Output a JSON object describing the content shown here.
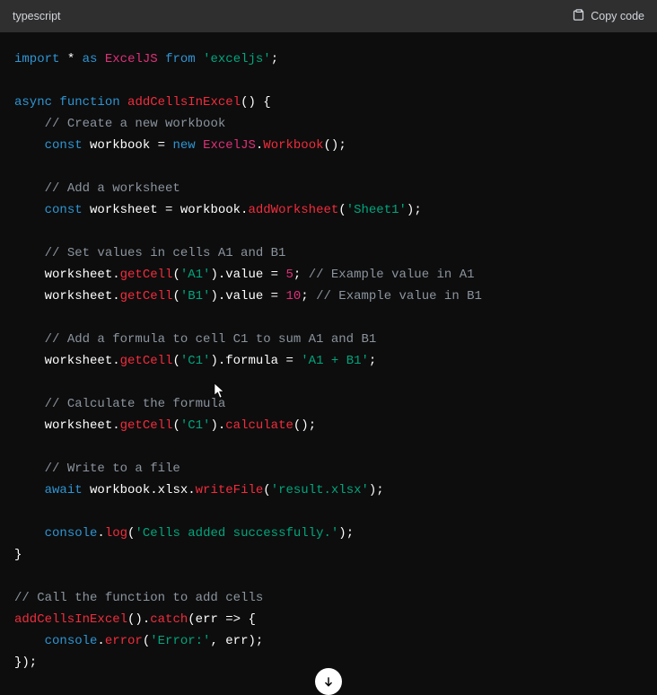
{
  "header": {
    "language": "typescript",
    "copy_label": "Copy code"
  },
  "code": {
    "tokens": [
      [
        {
          "t": "kw",
          "v": "import"
        },
        {
          "t": "pln",
          "v": " * "
        },
        {
          "t": "kw",
          "v": "as"
        },
        {
          "t": "pln",
          "v": " "
        },
        {
          "t": "mod",
          "v": "ExcelJS"
        },
        {
          "t": "pln",
          "v": " "
        },
        {
          "t": "kw",
          "v": "from"
        },
        {
          "t": "pln",
          "v": " "
        },
        {
          "t": "str",
          "v": "'exceljs'"
        },
        {
          "t": "pln",
          "v": ";"
        }
      ],
      [],
      [
        {
          "t": "kw",
          "v": "async"
        },
        {
          "t": "pln",
          "v": " "
        },
        {
          "t": "kw",
          "v": "function"
        },
        {
          "t": "pln",
          "v": " "
        },
        {
          "t": "fn",
          "v": "addCellsInExcel"
        },
        {
          "t": "pln",
          "v": "() {"
        }
      ],
      [
        {
          "t": "pln",
          "v": "    "
        },
        {
          "t": "cmt",
          "v": "// Create a new workbook"
        }
      ],
      [
        {
          "t": "pln",
          "v": "    "
        },
        {
          "t": "kw",
          "v": "const"
        },
        {
          "t": "pln",
          "v": " workbook = "
        },
        {
          "t": "kw",
          "v": "new"
        },
        {
          "t": "pln",
          "v": " "
        },
        {
          "t": "mod",
          "v": "ExcelJS"
        },
        {
          "t": "pln",
          "v": "."
        },
        {
          "t": "fn",
          "v": "Workbook"
        },
        {
          "t": "pln",
          "v": "();"
        }
      ],
      [],
      [
        {
          "t": "pln",
          "v": "    "
        },
        {
          "t": "cmt",
          "v": "// Add a worksheet"
        }
      ],
      [
        {
          "t": "pln",
          "v": "    "
        },
        {
          "t": "kw",
          "v": "const"
        },
        {
          "t": "pln",
          "v": " worksheet = workbook."
        },
        {
          "t": "fn",
          "v": "addWorksheet"
        },
        {
          "t": "pln",
          "v": "("
        },
        {
          "t": "str",
          "v": "'Sheet1'"
        },
        {
          "t": "pln",
          "v": ");"
        }
      ],
      [],
      [
        {
          "t": "pln",
          "v": "    "
        },
        {
          "t": "cmt",
          "v": "// Set values in cells A1 and B1"
        }
      ],
      [
        {
          "t": "pln",
          "v": "    worksheet."
        },
        {
          "t": "fn",
          "v": "getCell"
        },
        {
          "t": "pln",
          "v": "("
        },
        {
          "t": "str",
          "v": "'A1'"
        },
        {
          "t": "pln",
          "v": ").value = "
        },
        {
          "t": "num",
          "v": "5"
        },
        {
          "t": "pln",
          "v": "; "
        },
        {
          "t": "cmt",
          "v": "// Example value in A1"
        }
      ],
      [
        {
          "t": "pln",
          "v": "    worksheet."
        },
        {
          "t": "fn",
          "v": "getCell"
        },
        {
          "t": "pln",
          "v": "("
        },
        {
          "t": "str",
          "v": "'B1'"
        },
        {
          "t": "pln",
          "v": ").value = "
        },
        {
          "t": "num",
          "v": "10"
        },
        {
          "t": "pln",
          "v": "; "
        },
        {
          "t": "cmt",
          "v": "// Example value in B1"
        }
      ],
      [],
      [
        {
          "t": "pln",
          "v": "    "
        },
        {
          "t": "cmt",
          "v": "// Add a formula to cell C1 to sum A1 and B1"
        }
      ],
      [
        {
          "t": "pln",
          "v": "    worksheet."
        },
        {
          "t": "fn",
          "v": "getCell"
        },
        {
          "t": "pln",
          "v": "("
        },
        {
          "t": "str",
          "v": "'C1'"
        },
        {
          "t": "pln",
          "v": ").formula = "
        },
        {
          "t": "str",
          "v": "'A1 + B1'"
        },
        {
          "t": "pln",
          "v": ";"
        }
      ],
      [],
      [
        {
          "t": "pln",
          "v": "    "
        },
        {
          "t": "cmt",
          "v": "// Calculate the formula"
        }
      ],
      [
        {
          "t": "pln",
          "v": "    worksheet."
        },
        {
          "t": "fn",
          "v": "getCell"
        },
        {
          "t": "pln",
          "v": "("
        },
        {
          "t": "str",
          "v": "'C1'"
        },
        {
          "t": "pln",
          "v": ")."
        },
        {
          "t": "fn",
          "v": "calculate"
        },
        {
          "t": "pln",
          "v": "();"
        }
      ],
      [],
      [
        {
          "t": "pln",
          "v": "    "
        },
        {
          "t": "cmt",
          "v": "// Write to a file"
        }
      ],
      [
        {
          "t": "pln",
          "v": "    "
        },
        {
          "t": "kw",
          "v": "await"
        },
        {
          "t": "pln",
          "v": " workbook.xlsx."
        },
        {
          "t": "fn",
          "v": "writeFile"
        },
        {
          "t": "pln",
          "v": "("
        },
        {
          "t": "str",
          "v": "'result.xlsx'"
        },
        {
          "t": "pln",
          "v": ");"
        }
      ],
      [],
      [
        {
          "t": "pln",
          "v": "    "
        },
        {
          "t": "kw",
          "v": "console"
        },
        {
          "t": "pln",
          "v": "."
        },
        {
          "t": "fn",
          "v": "log"
        },
        {
          "t": "pln",
          "v": "("
        },
        {
          "t": "str",
          "v": "'Cells added successfully.'"
        },
        {
          "t": "pln",
          "v": ");"
        }
      ],
      [
        {
          "t": "pln",
          "v": "}"
        }
      ],
      [],
      [
        {
          "t": "cmt",
          "v": "// Call the function to add cells"
        }
      ],
      [
        {
          "t": "fn",
          "v": "addCellsInExcel"
        },
        {
          "t": "pln",
          "v": "()."
        },
        {
          "t": "fn",
          "v": "catch"
        },
        {
          "t": "pln",
          "v": "(err => {"
        }
      ],
      [
        {
          "t": "pln",
          "v": "    "
        },
        {
          "t": "kw",
          "v": "console"
        },
        {
          "t": "pln",
          "v": "."
        },
        {
          "t": "fn",
          "v": "error"
        },
        {
          "t": "pln",
          "v": "("
        },
        {
          "t": "str",
          "v": "'Error:'"
        },
        {
          "t": "pln",
          "v": ", err);"
        }
      ],
      [
        {
          "t": "pln",
          "v": "});"
        }
      ]
    ]
  }
}
